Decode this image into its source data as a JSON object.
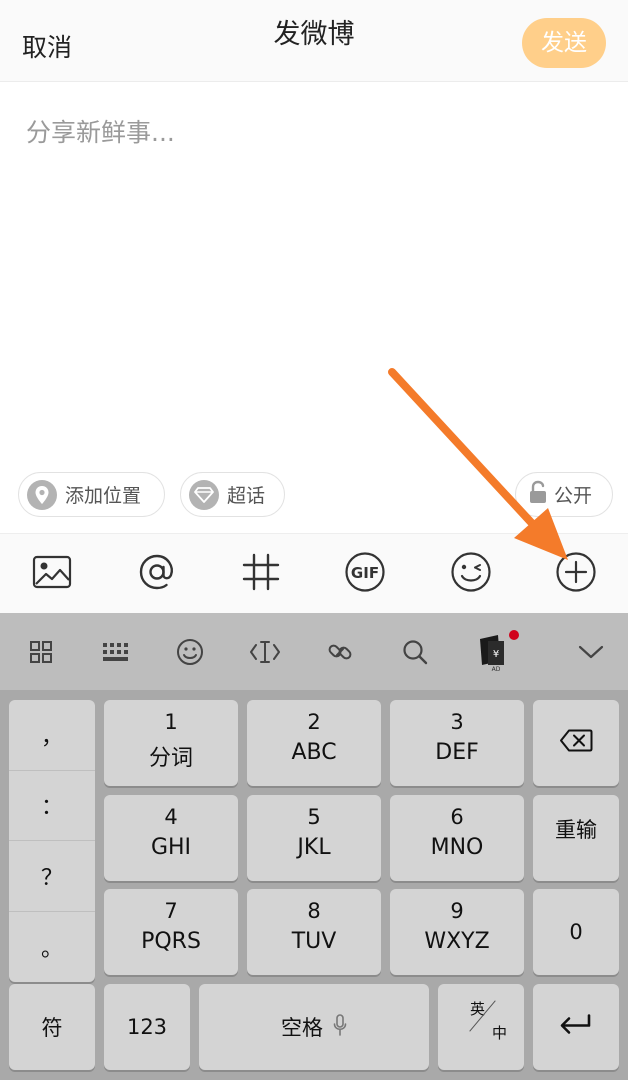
{
  "header": {
    "cancel": "取消",
    "title": "发微博",
    "send": "发送"
  },
  "compose": {
    "placeholder": "分享新鲜事..."
  },
  "chips": {
    "location": "添加位置",
    "topic": "超话",
    "visibility": "公开"
  },
  "toolbar": {
    "icons": [
      "image-icon",
      "mention-icon",
      "hashtag-icon",
      "gif-icon",
      "emoji-icon",
      "add-icon"
    ],
    "gif_label": "GIF"
  },
  "keyboard_bar": {
    "icons": [
      "grid-icon",
      "keyboard-icon",
      "emoji-icon",
      "cursor-icon",
      "link-icon",
      "search-icon",
      "ad-icon",
      "collapse-icon"
    ],
    "ad_label": "AD"
  },
  "keyboard": {
    "punct": [
      "，",
      "：",
      "？",
      "。"
    ],
    "keys": [
      {
        "num": "1",
        "letters": "分词"
      },
      {
        "num": "2",
        "letters": "ABC"
      },
      {
        "num": "3",
        "letters": "DEF"
      },
      {
        "num": "4",
        "letters": "GHI"
      },
      {
        "num": "5",
        "letters": "JKL"
      },
      {
        "num": "6",
        "letters": "MNO"
      },
      {
        "num": "7",
        "letters": "PQRS"
      },
      {
        "num": "8",
        "letters": "TUV"
      },
      {
        "num": "9",
        "letters": "WXYZ"
      }
    ],
    "retype": "重输",
    "zero": "0",
    "symbols": "符",
    "numbers": "123",
    "space": "空格",
    "lang_top": "英",
    "lang_bottom": "中"
  },
  "colors": {
    "send_button": "#ffcf8a",
    "arrow": "#f47b2a",
    "keyboard_bg": "#a9a9a9",
    "key_bg": "#d4d4d4",
    "badge": "#d0021b"
  }
}
